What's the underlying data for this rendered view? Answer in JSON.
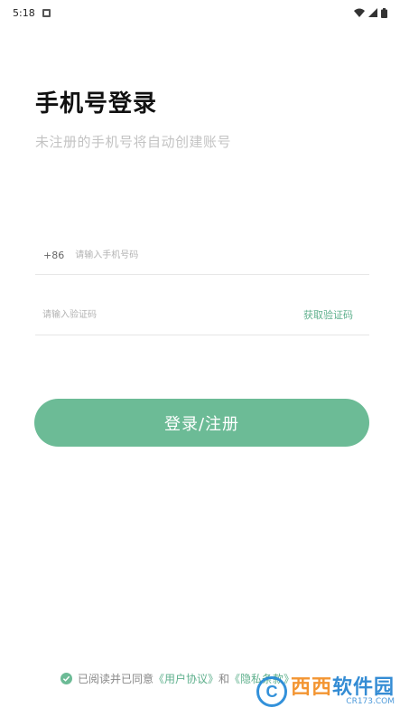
{
  "status_bar": {
    "time": "5:18"
  },
  "header": {
    "title": "手机号登录",
    "subtitle": "未注册的手机号将自动创建账号"
  },
  "phone": {
    "country_code": "+86",
    "placeholder": "请输入手机号码"
  },
  "code": {
    "placeholder": "请输入验证码",
    "get_code_label": "获取验证码"
  },
  "login_button": {
    "label": "登录/注册"
  },
  "agreement": {
    "prefix": "已阅读并已同意",
    "user_agreement": "《用户协议》",
    "and": "和",
    "privacy_policy": "《隐私条款》"
  },
  "watermark": {
    "brand_a": "西西",
    "brand_b": "软件园",
    "sub": "CR173.COM"
  },
  "colors": {
    "accent": "#6cbb96",
    "link": "#5fb08d"
  }
}
